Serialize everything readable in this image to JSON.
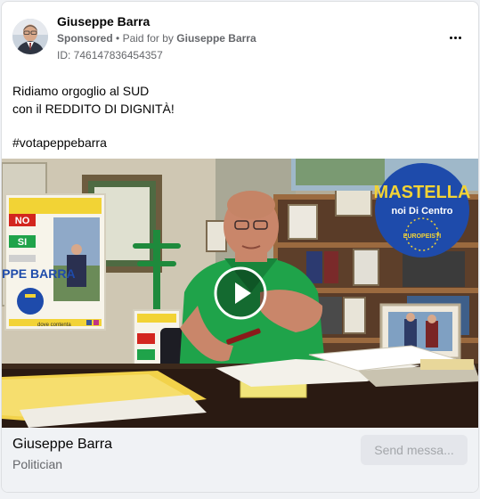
{
  "post": {
    "author": "Giuseppe Barra",
    "sponsored_label": "Sponsored",
    "separator": "•",
    "paid_for_prefix": "Paid for by",
    "paid_for_name": "Giuseppe Barra",
    "ad_id_label": "ID: 746147836454357",
    "text_line1": "Ridiamo orgoglio al SUD",
    "text_line2": "con il REDDITO DI DIGNITÀ!",
    "hashtag": "#votapeppebarra"
  },
  "video": {
    "mastella_logo": {
      "title": "MASTELLA",
      "subtitle": "noi Di Centro",
      "badge": "EUROPEISTI"
    },
    "poster": {
      "badge": "NO",
      "yes_badge": "SI",
      "name": "PEPPE BARRA",
      "footer_text": "dove contenta"
    }
  },
  "footer": {
    "page_name": "Giuseppe Barra",
    "category": "Politician",
    "cta_label": "Send messa..."
  },
  "colors": {
    "brand_blue": "#1e4bab",
    "shirt_green": "#1fa34a",
    "poster_yellow": "#f2d335",
    "muted_text": "#65676b",
    "button_bg": "#e4e6eb"
  },
  "icons": [
    "more-options-icon",
    "play-icon"
  ]
}
